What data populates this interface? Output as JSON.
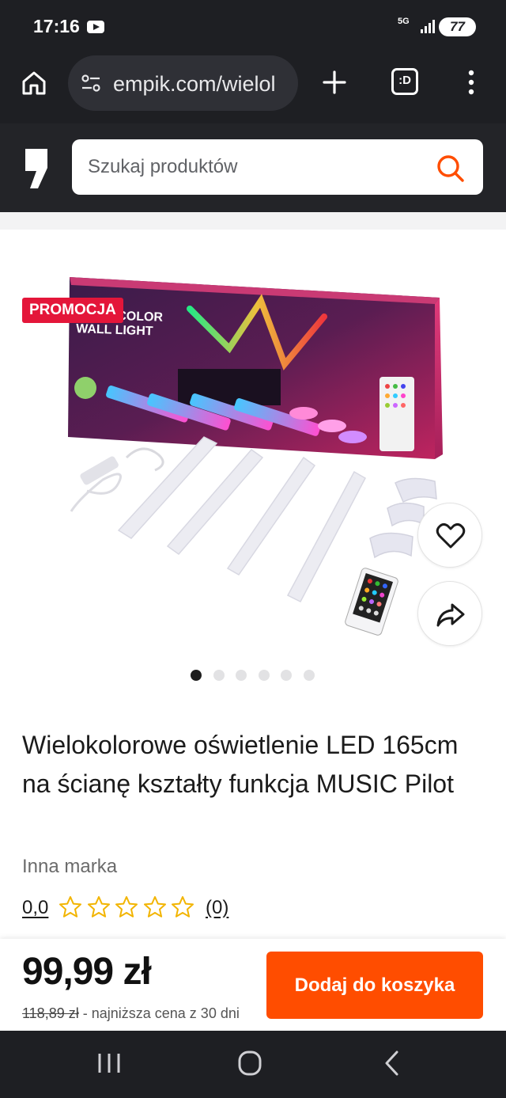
{
  "status_bar": {
    "time": "17:16",
    "network": "5G",
    "battery": "77",
    "app_icon": "youtube-icon"
  },
  "browser": {
    "url": "empik.com/wielol",
    "tabs_label": ":D",
    "icons": [
      "home-icon",
      "site-settings-icon",
      "new-tab-icon",
      "tabs-icon",
      "menu-icon"
    ]
  },
  "site_header": {
    "search_placeholder": "Szukaj produktów",
    "accent": "#ff4d00"
  },
  "product": {
    "badge": "PROMOCJA",
    "image_count": 6,
    "active_image": 1,
    "title": "Wielokolorowe oświetlenie LED 165cm na ścianę kształty funkcja MUSIC Pilot",
    "brand": "Inna marka",
    "rating": "0,0",
    "stars_total": 5,
    "stars_filled": 0,
    "rating_count": "(0)"
  },
  "price_bar": {
    "price": "99,99 zł",
    "old_price": "118,89 zł",
    "old_price_note": "- najniższa cena z 30 dni",
    "cta_label": "Dodaj do koszyka"
  },
  "colors": {
    "promo": "#e4163a",
    "cta": "#ff4d00",
    "star": "#f2b400"
  }
}
